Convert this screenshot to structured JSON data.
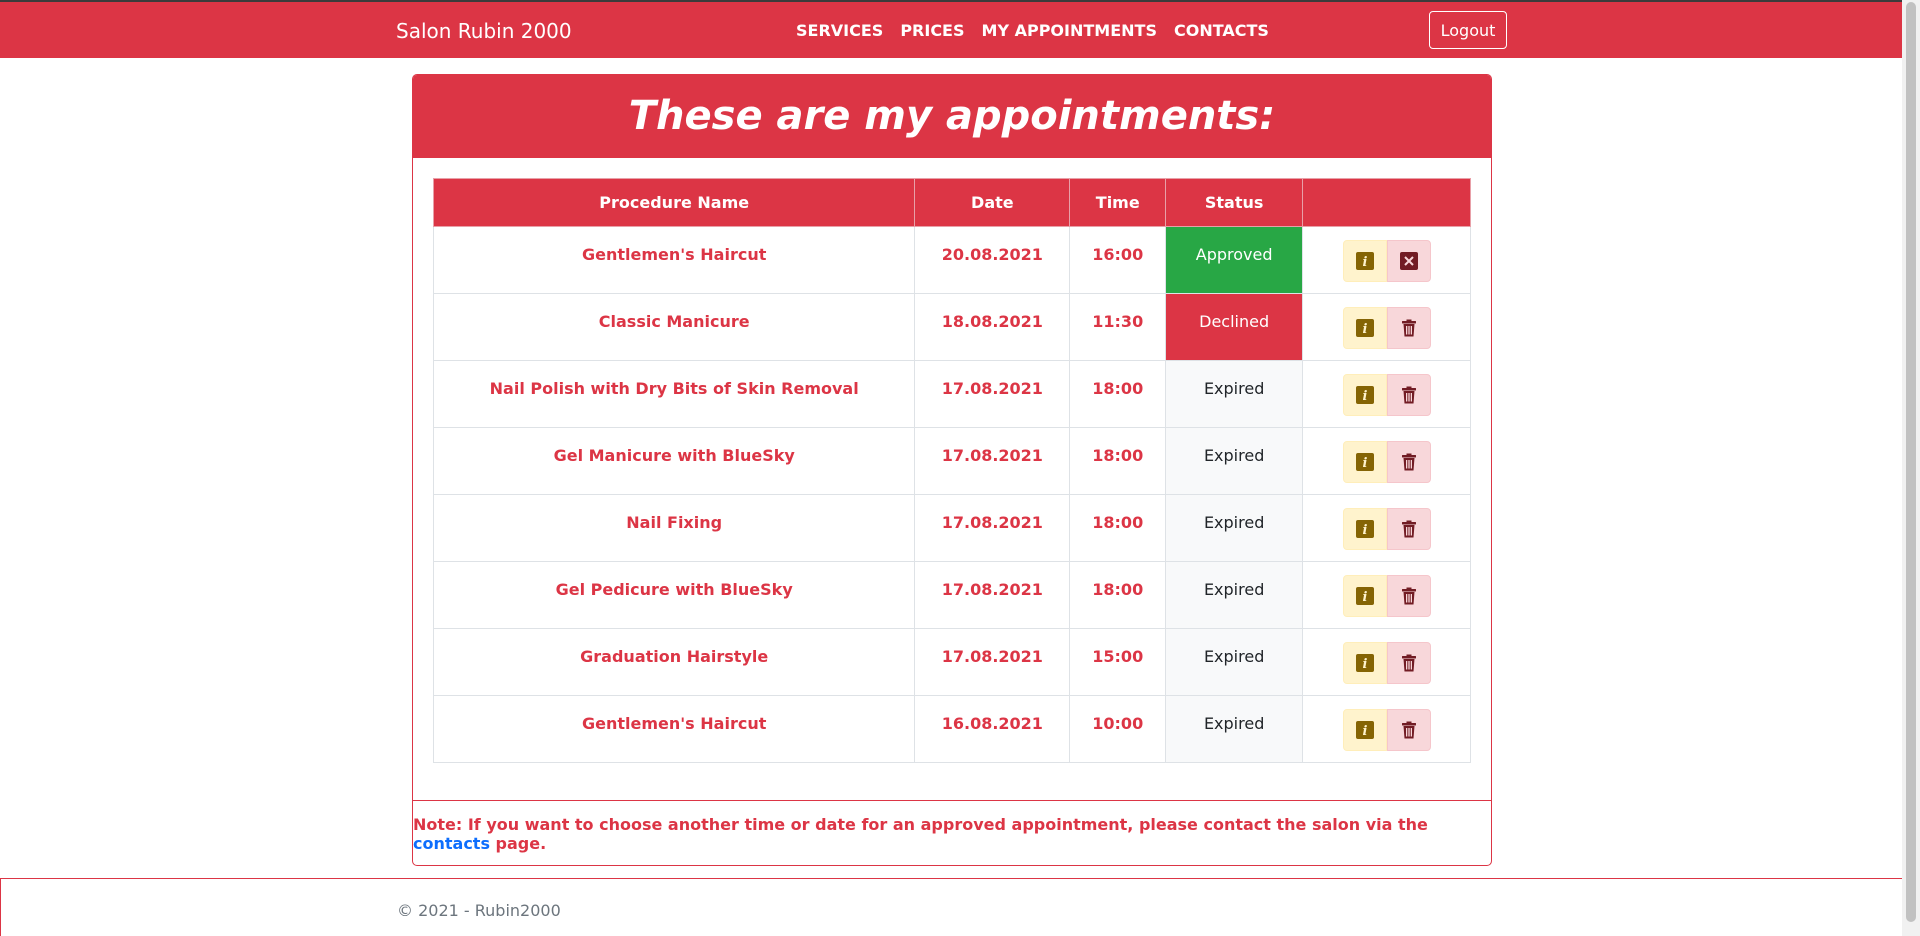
{
  "navbar": {
    "brand": "Salon Rubin 2000",
    "links": [
      "SERVICES",
      "PRICES",
      "MY APPOINTMENTS",
      "CONTACTS"
    ],
    "logout_label": "Logout"
  },
  "card": {
    "title": "These are my appointments:"
  },
  "table": {
    "headers": [
      "Procedure Name",
      "Date",
      "Time",
      "Status",
      ""
    ],
    "rows": [
      {
        "name": "Gentlemen's Haircut",
        "date": "20.08.2021",
        "time": "16:00",
        "status": "Approved",
        "action": "cancel"
      },
      {
        "name": "Classic Manicure",
        "date": "18.08.2021",
        "time": "11:30",
        "status": "Declined",
        "action": "delete"
      },
      {
        "name": "Nail Polish with Dry Bits of Skin Removal",
        "date": "17.08.2021",
        "time": "18:00",
        "status": "Expired",
        "action": "delete"
      },
      {
        "name": "Gel Manicure with BlueSky",
        "date": "17.08.2021",
        "time": "18:00",
        "status": "Expired",
        "action": "delete"
      },
      {
        "name": "Nail Fixing",
        "date": "17.08.2021",
        "time": "18:00",
        "status": "Expired",
        "action": "delete"
      },
      {
        "name": "Gel Pedicure with BlueSky",
        "date": "17.08.2021",
        "time": "18:00",
        "status": "Expired",
        "action": "delete"
      },
      {
        "name": "Graduation Hairstyle",
        "date": "17.08.2021",
        "time": "15:00",
        "status": "Expired",
        "action": "delete"
      },
      {
        "name": "Gentlemen's Haircut",
        "date": "16.08.2021",
        "time": "10:00",
        "status": "Expired",
        "action": "delete"
      }
    ]
  },
  "note": {
    "before": "Note: If you want to choose another time or date for an approved appointment, please contact the salon via the ",
    "link": "contacts",
    "after": " page."
  },
  "footer": {
    "text": "© 2021 - Rubin2000"
  },
  "colors": {
    "primary": "#dc3545",
    "approved": "#28a745",
    "link": "#0d6efd"
  },
  "icons": {
    "info": "info-icon",
    "delete": "trash-icon",
    "cancel": "close-icon"
  }
}
